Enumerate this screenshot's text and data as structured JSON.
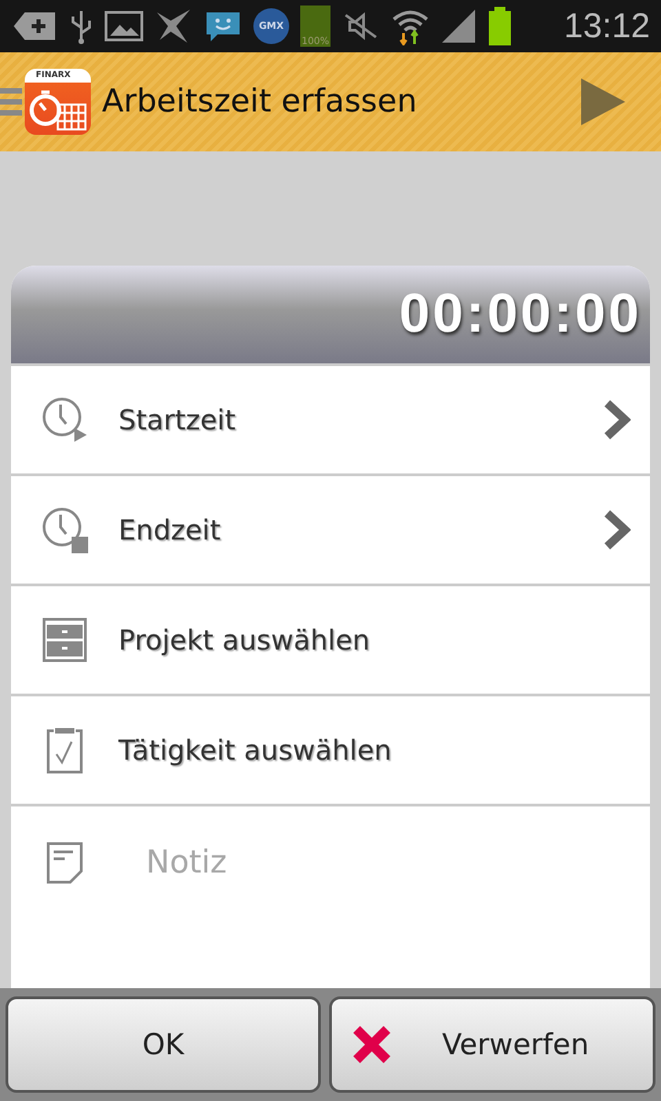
{
  "status_bar": {
    "battery_label": "100%",
    "mail_badge": "GMX",
    "time": "13:12"
  },
  "action_bar": {
    "logo_text": "FINARX",
    "title": "Arbeitszeit erfassen"
  },
  "timer": {
    "value": "00:00:00"
  },
  "rows": [
    {
      "kind": "link",
      "label": "Startzeit"
    },
    {
      "kind": "link",
      "label": "Endzeit"
    },
    {
      "kind": "select",
      "label": "Projekt auswählen"
    },
    {
      "kind": "select",
      "label": "Tätigkeit auswählen"
    }
  ],
  "note": {
    "placeholder": "Notiz"
  },
  "buttons": [
    {
      "kind": "ok",
      "label": "OK"
    },
    {
      "kind": "discard",
      "label": "Verwerfen"
    }
  ]
}
